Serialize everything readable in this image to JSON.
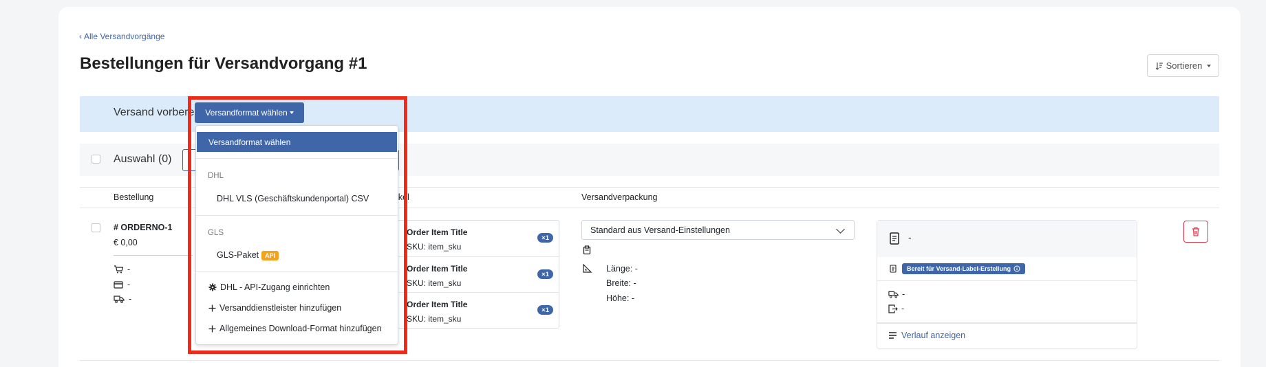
{
  "nav": {
    "back_label": "Alle Versandvorgänge"
  },
  "page": {
    "title": "Bestellungen für Versandvorgang #1",
    "sort_label": "Sortieren"
  },
  "banner": {
    "label": "Versand vorbereiten:",
    "format_button": "Versandformat wählen"
  },
  "selection": {
    "label": "Auswahl (0)"
  },
  "table": {
    "headers": {
      "order": "Bestellung",
      "items": "Artikel",
      "packaging": "Versandverpackung"
    },
    "row": {
      "order_no": "# ORDERNO-1",
      "price": "€ 0,00",
      "cart_value": "-",
      "payment_value": "-",
      "shipping_value": "-",
      "items": [
        {
          "title": "Order Item Title",
          "sku": "SKU: item_sku",
          "qty": "×1"
        },
        {
          "title": "Order Item Title",
          "sku": "SKU: item_sku",
          "qty": "×1"
        },
        {
          "title": "Order Item Title",
          "sku": "SKU: item_sku",
          "qty": "×1"
        }
      ],
      "packaging_select": "Standard aus Versand-Einstellungen",
      "dimensions": {
        "length": "Länge: -",
        "width": "Breite: -",
        "height": "Höhe: -"
      },
      "status": {
        "doc_value": "-",
        "badge": "Bereit für Versand-Label-Erstellung",
        "tracking_value": "-",
        "return_value": "-",
        "history_link": "Verlauf anzeigen"
      }
    }
  },
  "dropdown": {
    "active_item": "Versandformat wählen",
    "groups": [
      {
        "header": "DHL",
        "items": [
          {
            "label": "DHL VLS (Geschäftskundenportal) CSV"
          }
        ]
      },
      {
        "header": "GLS",
        "items": [
          {
            "label": "GLS-Paket",
            "badge": "API"
          }
        ]
      }
    ],
    "actions": [
      {
        "label": "DHL - API-Zugang einrichten",
        "icon": "gear-icon"
      },
      {
        "label": "Versanddienstleister hinzufügen",
        "icon": "plus-icon"
      },
      {
        "label": "Allgemeines Download-Format hinzufügen",
        "icon": "plus-icon"
      }
    ]
  },
  "colors": {
    "primary": "#3e66a8",
    "banner": "#dcebf9",
    "highlight": "#ee2a1b",
    "danger": "#d9364a",
    "api_badge": "#f3a21b"
  }
}
